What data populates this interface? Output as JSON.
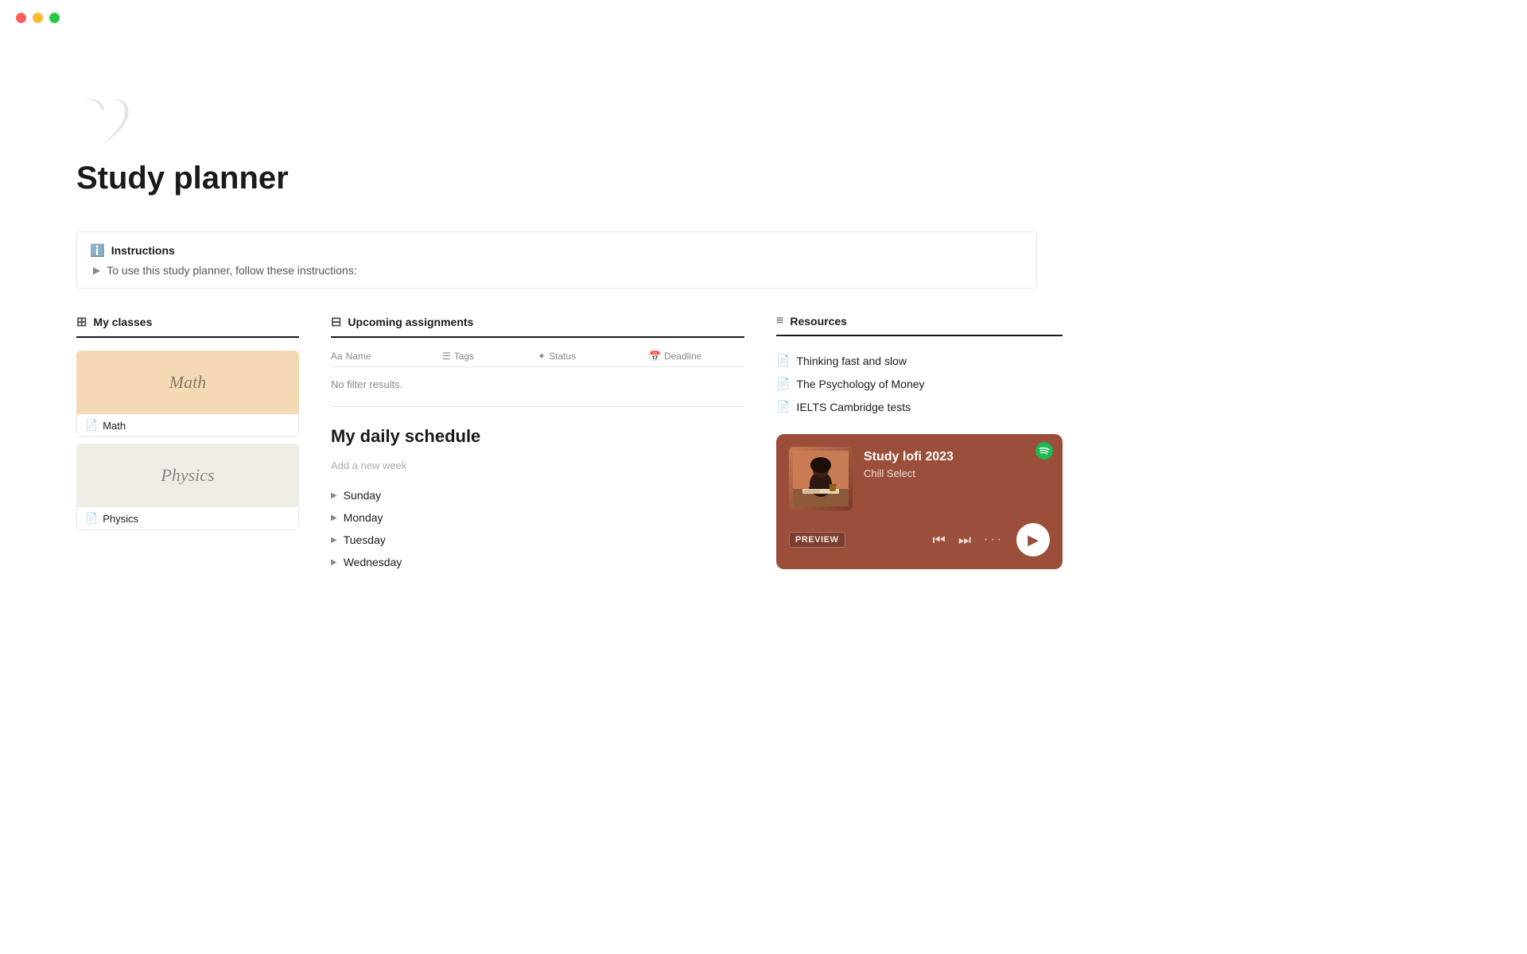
{
  "trafficLights": {
    "red": "#ff5f57",
    "yellow": "#febc2e",
    "green": "#28c840"
  },
  "page": {
    "icon": "🤍",
    "title": "Study planner"
  },
  "instructions": {
    "header": "Instructions",
    "body": "To use this study planner, follow these instructions:"
  },
  "myClasses": {
    "label": "My classes",
    "items": [
      {
        "name": "Math",
        "bgColor": "#f5d9b5",
        "textColor": "rgba(0,0,0,0.45)"
      },
      {
        "name": "Physics",
        "bgColor": "#f0ede7",
        "textColor": "rgba(0,0,0,0.45)"
      }
    ]
  },
  "upcomingAssignments": {
    "label": "Upcoming assignments",
    "columns": [
      "Name",
      "Tags",
      "Status",
      "Deadline"
    ],
    "noResults": "No filter results."
  },
  "dailySchedule": {
    "title": "My daily schedule",
    "addWeekPlaceholder": "Add a new week",
    "days": [
      "Sunday",
      "Monday",
      "Tuesday",
      "Wednesday"
    ]
  },
  "resources": {
    "label": "Resources",
    "items": [
      "Thinking fast and slow",
      "The Psychology of Money",
      "IELTS Cambridge tests"
    ]
  },
  "spotify": {
    "title": "Study lofi 2023",
    "subtitle": "Chill Select",
    "previewLabel": "PREVIEW"
  }
}
